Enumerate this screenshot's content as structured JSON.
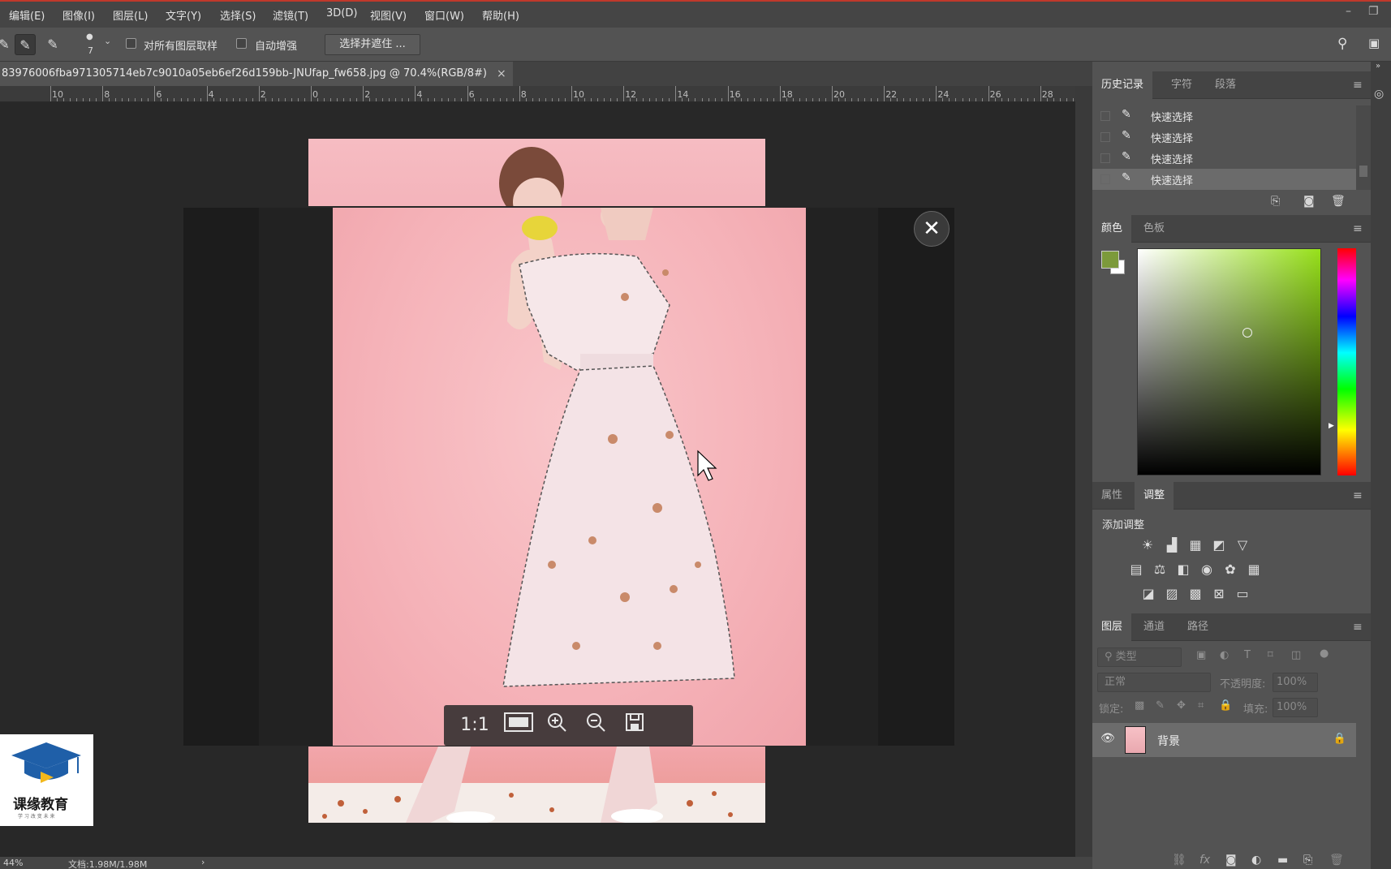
{
  "menu": [
    "编辑(E)",
    "图像(I)",
    "图层(L)",
    "文字(Y)",
    "选择(S)",
    "滤镜(T)",
    "3D(D)",
    "视图(V)",
    "窗口(W)",
    "帮助(H)"
  ],
  "options": {
    "brush_size": "7",
    "sample_all_layers": "对所有图层取样",
    "auto_enhance": "自动增强",
    "select_and_mask": "选择并遮住 ..."
  },
  "document": {
    "tab_title": "83976006fba971305714eb7c9010a05eb6ef26d159bb-JNUfap_fw658.jpg @ 70.4%(RGB/8#)",
    "close": "×"
  },
  "ruler": {
    "labels": [
      "10",
      "8",
      "6",
      "4",
      "2",
      "0",
      "2",
      "4",
      "6",
      "8",
      "10",
      "12",
      "14",
      "16",
      "18",
      "20",
      "22",
      "24",
      "26",
      "28"
    ]
  },
  "status": {
    "zoom": "44%",
    "doc_size": "文档:1.98M/1.98M",
    "arrow": "›"
  },
  "viewer": {
    "close": "✕",
    "ratio": "1:1"
  },
  "history_panel": {
    "tabs": [
      "历史记录",
      "字符",
      "段落"
    ],
    "items": [
      "快速选择",
      "快速选择",
      "快速选择",
      "快速选择"
    ],
    "selected_index": 3
  },
  "color_panel": {
    "tabs": [
      "颜色",
      "色板"
    ],
    "foreground": "#7c9a3b",
    "background": "#ffffff",
    "field_hue": "#97e01a"
  },
  "adjust_panel": {
    "tabs": [
      "属性",
      "调整"
    ],
    "heading": "添加调整"
  },
  "layers_panel": {
    "tabs": [
      "图层",
      "通道",
      "路径"
    ],
    "filter_placeholder": "类型",
    "blend_mode": "正常",
    "opacity_label": "不透明度:",
    "opacity_value": "100%",
    "lock_label": "锁定:",
    "fill_label": "填充:",
    "fill_value": "100%",
    "layer_name": "背景"
  },
  "logo": {
    "title": "课缘教育",
    "subtitle": "学 习 改 变 未 来"
  }
}
